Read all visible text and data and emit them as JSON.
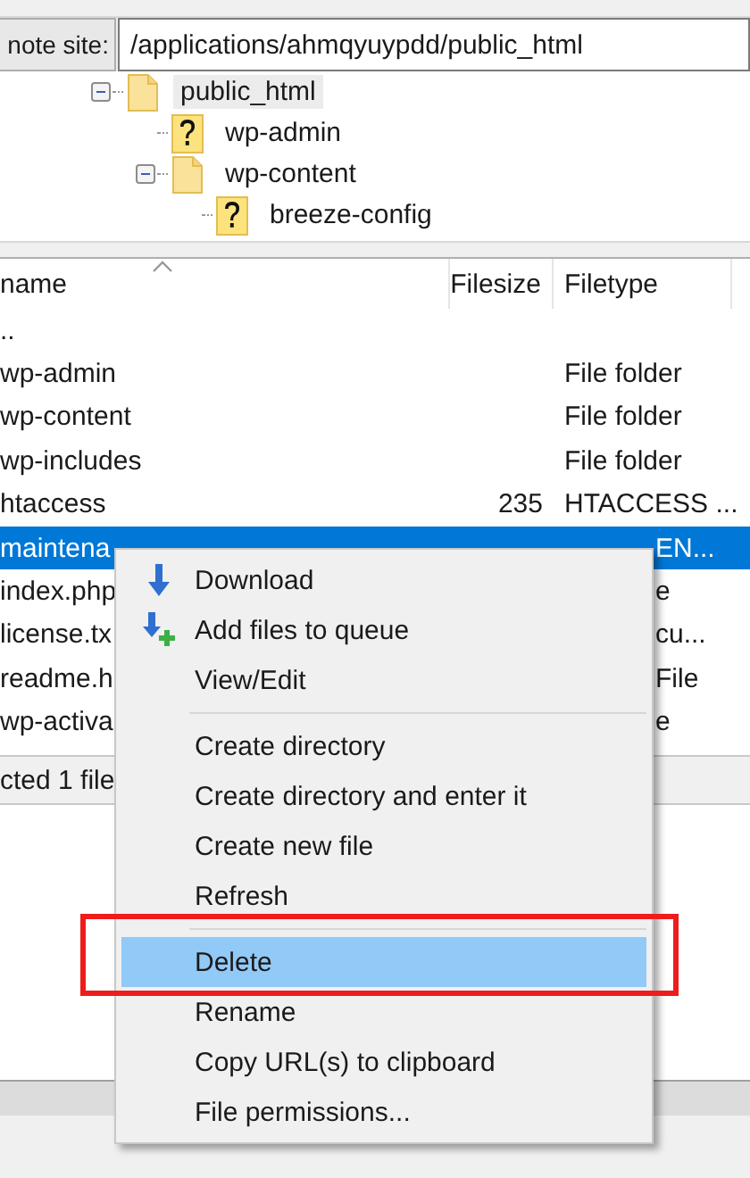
{
  "remote_site": {
    "label": "note site:",
    "path": "/applications/ahmqyuypdd/public_html"
  },
  "tree": [
    {
      "label": "public_html",
      "kind": "folder",
      "expanded": true,
      "selected": true,
      "children": [
        {
          "label": "wp-admin",
          "kind": "unknown",
          "selected": false
        },
        {
          "label": "wp-content",
          "kind": "folder",
          "expanded": true,
          "selected": false,
          "children": [
            {
              "label": "breeze-config",
              "kind": "unknown",
              "selected": false
            }
          ]
        }
      ]
    }
  ],
  "file_list": {
    "columns": [
      "name",
      "Filesize",
      "Filetype"
    ],
    "rows": [
      {
        "kind": "full",
        "name": "..",
        "selected": false
      },
      {
        "kind": "full",
        "name": "wp-admin",
        "filetype": "File folder",
        "selected": false
      },
      {
        "kind": "full",
        "name": "wp-content",
        "filetype": "File folder",
        "selected": false
      },
      {
        "kind": "full",
        "name": "wp-includes",
        "filetype": "File folder",
        "selected": false
      },
      {
        "kind": "full",
        "name": "htaccess",
        "filesize": "235",
        "filetype": "HTACCESS ...",
        "selected": false
      },
      {
        "kind": "covered",
        "name": "maintena",
        "filetype": "EN...",
        "selected": true
      },
      {
        "kind": "covered",
        "name": "index.php",
        "filetype": "e",
        "selected": false
      },
      {
        "kind": "covered",
        "name": "license.tx",
        "filetype": "cu...",
        "selected": false
      },
      {
        "kind": "covered",
        "name": "readme.h",
        "filetype": "File",
        "selected": false
      },
      {
        "kind": "covered",
        "name": "wp-activa",
        "filetype": "e",
        "selected": false
      }
    ]
  },
  "status": "cted 1 file",
  "context_menu": {
    "items": [
      {
        "kind": "download",
        "label": "Download",
        "highlighted": false
      },
      {
        "kind": "add",
        "label": "Add files to queue",
        "highlighted": false
      },
      {
        "kind": "item",
        "label": "View/Edit",
        "highlighted": false
      },
      {
        "kind": "separator"
      },
      {
        "kind": "item",
        "label": "Create directory",
        "highlighted": false
      },
      {
        "kind": "item",
        "label": "Create directory and enter it",
        "highlighted": false
      },
      {
        "kind": "item",
        "label": "Create new file",
        "highlighted": false
      },
      {
        "kind": "item",
        "label": "Refresh",
        "highlighted": false
      },
      {
        "kind": "separator"
      },
      {
        "kind": "item",
        "label": "Delete",
        "highlighted": true
      },
      {
        "kind": "item",
        "label": "Rename",
        "highlighted": false
      },
      {
        "kind": "item",
        "label": "Copy URL(s) to clipboard",
        "highlighted": false
      },
      {
        "kind": "item",
        "label": "File permissions...",
        "highlighted": false
      }
    ]
  }
}
